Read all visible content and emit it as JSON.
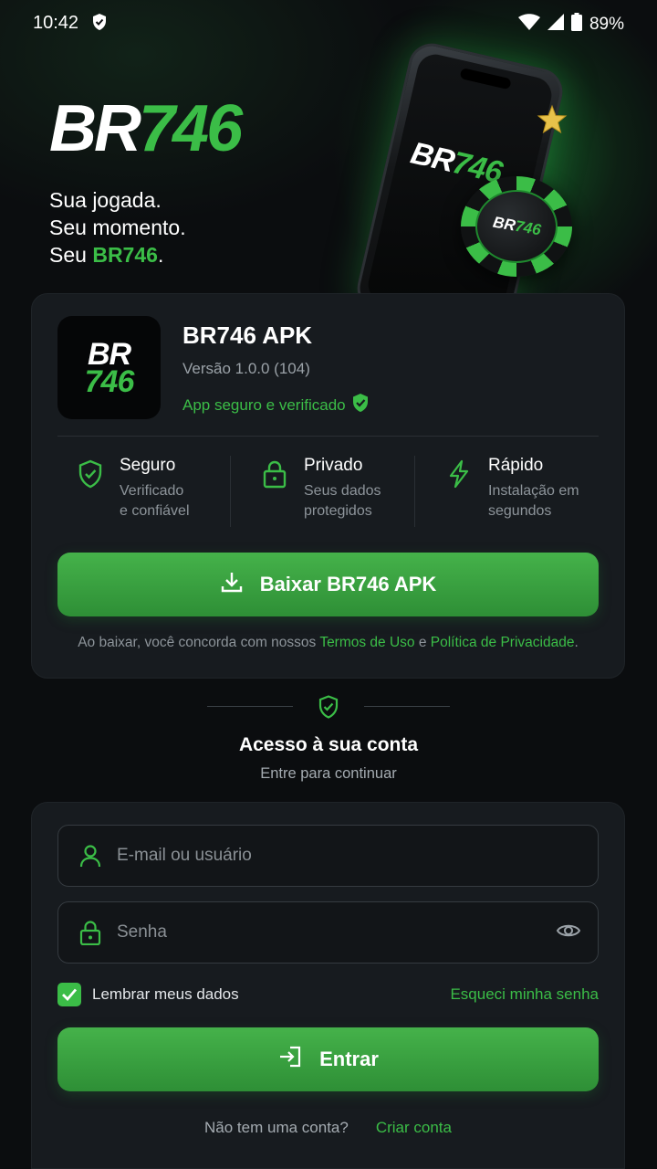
{
  "status_bar": {
    "time": "10:42",
    "battery": "89%"
  },
  "hero": {
    "logo_br": "BR",
    "logo_num": "746",
    "tagline_1": "Sua jogada.",
    "tagline_2": "Seu momento.",
    "tagline_3_prefix": "Seu ",
    "tagline_3_brand": "BR746",
    "tagline_3_suffix": ".",
    "phone_logo_br": "BR",
    "phone_logo_num": "746",
    "chip_logo_br": "BR",
    "chip_logo_num": "746"
  },
  "apk": {
    "icon_br": "BR",
    "icon_num": "746",
    "name": "BR746 APK",
    "version": "Versão 1.0.0 (104)",
    "verified": "App seguro e verificado",
    "features": [
      {
        "title": "Seguro",
        "desc": "Verificado\ne confiável",
        "icon": "shield-check-icon"
      },
      {
        "title": "Privado",
        "desc": "Seus dados\nprotegidos",
        "icon": "lock-icon"
      },
      {
        "title": "Rápido",
        "desc": "Instalação em\nsegundos",
        "icon": "lightning-icon"
      }
    ],
    "download_label": "Baixar BR746 APK",
    "legal_prefix": "Ao baixar, você concorda com nossos ",
    "legal_terms": "Termos de Uso",
    "legal_and": " e ",
    "legal_privacy": "Política de Privacidade",
    "legal_suffix": "."
  },
  "access": {
    "title": "Acesso à sua conta",
    "subtitle": "Entre para continuar"
  },
  "login": {
    "user_placeholder": "E-mail ou usuário",
    "password_placeholder": "Senha",
    "remember_label": "Lembrar meus dados",
    "remember_checked": true,
    "forgot_label": "Esqueci minha senha",
    "submit_label": "Entrar",
    "signup_prompt": "Não tem uma conta?",
    "signup_link": "Criar conta"
  },
  "colors": {
    "accent": "#3bbd47",
    "background": "#0b0d0f",
    "card": "#171b1f"
  }
}
